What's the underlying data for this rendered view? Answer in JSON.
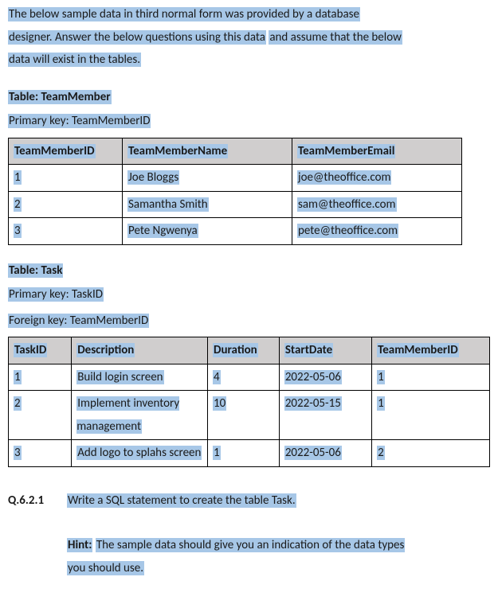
{
  "intro": {
    "l1": "The below sample data in third normal form was provided by a database",
    "l2a": "designer. Answer the below questions using this data",
    "l2b": " and assume that the below",
    "l3": "data will exist in the tables."
  },
  "tableTM": {
    "heading": "Table: TeamMember",
    "pk": "Primary key: TeamMemberID",
    "headers": [
      "TeamMemberID",
      "TeamMemberName",
      "TeamMemberEmail"
    ],
    "rows": [
      [
        "1",
        "Joe Bloggs",
        "joe@theoffice.com"
      ],
      [
        "2",
        "Samantha Smith",
        "sam@theoffice.com"
      ],
      [
        "3",
        "Pete Ngwenya",
        "pete@theoffice.com"
      ]
    ]
  },
  "tableTask": {
    "heading": "Table: Task",
    "pk": "Primary key: TaskID",
    "fk": "Foreign key: TeamMemberID",
    "headers": [
      "TaskID",
      "Description",
      "Duration",
      "StartDate",
      "TeamMemberID"
    ],
    "rows": [
      [
        "1",
        "Build login screen",
        "4",
        "2022-05-06",
        "1"
      ],
      [
        "2",
        "Implement inventory management",
        "10",
        "2022-05-15",
        "1"
      ],
      [
        "3",
        "Add logo to splahs screen",
        "1",
        "2022-05-06",
        "2"
      ]
    ]
  },
  "question": {
    "num": "Q.6.2.1",
    "text": "Write a SQL statement to create the table Task.",
    "hintLabel": "Hint:",
    "hintL1": "The sample data should give you an indication of the data types",
    "hintL2": "you should use."
  }
}
